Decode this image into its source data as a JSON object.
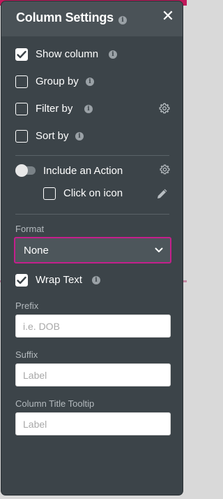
{
  "panel": {
    "title": "Column Settings",
    "info_glyph": "i",
    "close_glyph": "✕"
  },
  "options": {
    "show_column": {
      "label": "Show column",
      "checked": true
    },
    "group_by": {
      "label": "Group by",
      "checked": false
    },
    "filter_by": {
      "label": "Filter by",
      "checked": false
    },
    "sort_by": {
      "label": "Sort by",
      "checked": false
    }
  },
  "action": {
    "toggle_label": "Include an Action",
    "toggle_on": false,
    "click_on_icon_label": "Click on icon",
    "click_on_icon_checked": false
  },
  "format": {
    "label": "Format",
    "value": "None"
  },
  "wrap_text": {
    "label": "Wrap Text",
    "checked": true
  },
  "prefix": {
    "label": "Prefix",
    "placeholder": "i.e. DOB",
    "value": ""
  },
  "suffix": {
    "label": "Suffix",
    "placeholder": "Label",
    "value": ""
  },
  "tooltip": {
    "label": "Column Title Tooltip",
    "placeholder": "Label",
    "value": ""
  },
  "colors": {
    "panel_bg": "#3c4449",
    "accent_border": "#c41f8c"
  },
  "icons": [
    "info-icon",
    "close-icon",
    "checkbox-check-icon",
    "gear-icon",
    "pencil-icon",
    "chevron-down-icon"
  ]
}
